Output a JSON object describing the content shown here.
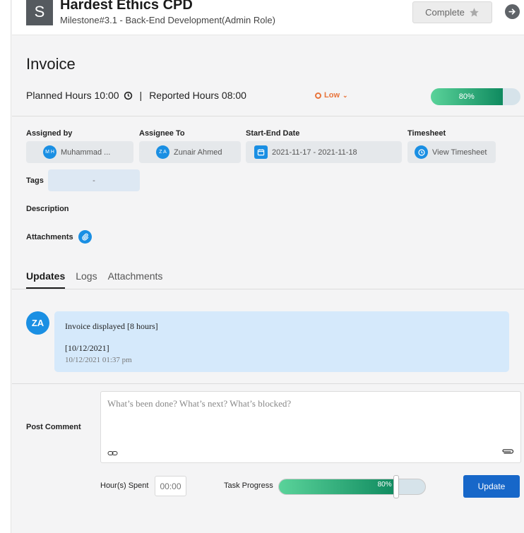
{
  "header": {
    "avatar_letter": "S",
    "project_title": "Hardest Ethics CPD",
    "milestone": "Milestone#3.1 - Back-End Development(Admin Role)",
    "complete_label": "Complete"
  },
  "task": {
    "title": "Invoice",
    "planned_hours_text": "Planned Hours 10:00",
    "separator": "|",
    "reported_hours_text": "Reported Hours 08:00",
    "priority": "Low",
    "progress_label": "80%",
    "progress_value": 80
  },
  "fields": {
    "assigned_by_label": "Assigned by",
    "assigned_by_initials": "M H",
    "assigned_by_name": "Muhammad ...",
    "assignee_label": "Assignee To",
    "assignee_initials": "Z A",
    "assignee_name": "Zunair Ahmed",
    "date_label": "Start-End Date",
    "date_value": "2021-11-17 - 2021-11-18",
    "timesheet_label": "Timesheet",
    "timesheet_value": "View Timesheet",
    "tags_label": "Tags",
    "tags_value": "-",
    "description_label": "Description",
    "attachments_label": "Attachments"
  },
  "tabs": [
    {
      "label": "Updates"
    },
    {
      "label": "Logs"
    },
    {
      "label": "Attachments"
    }
  ],
  "update": {
    "avatar_initials": "ZA",
    "text": "Invoice displayed [8 hours]",
    "date_bracket": "[10/12/2021]",
    "timestamp": "10/12/2021 01:37 pm"
  },
  "comment": {
    "label": "Post Comment",
    "placeholder": "What’s been done? What’s next? What’s blocked?",
    "hours_label": "Hour(s) Spent",
    "hours_placeholder": "00:00",
    "progress_label": "Task Progress",
    "progress_text": "80%",
    "progress_value": 80,
    "update_label": "Update"
  },
  "colors": {
    "accent": "#1a8fe3",
    "priority_low": "#e8743b",
    "progress_start": "#5ad39a",
    "progress_end": "#0f8a5f",
    "update_button": "#1767c9"
  }
}
